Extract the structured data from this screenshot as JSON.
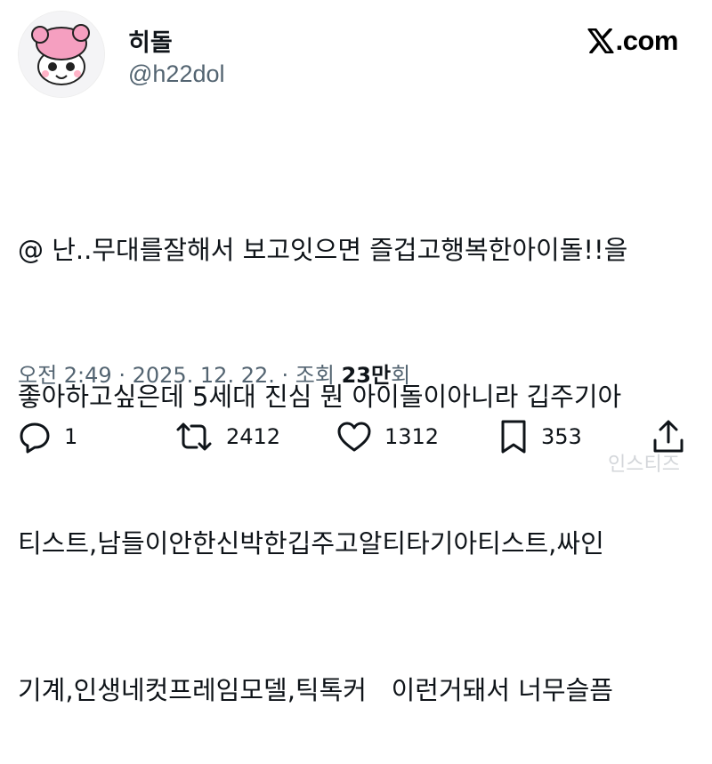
{
  "user": {
    "display_name": "히돌",
    "handle": "@h22dol"
  },
  "brand": {
    "label": ".com"
  },
  "tweet": {
    "lines": [
      "@ 난..무대를잘해서 보고잇으면 즐겁고행복한아이돌!!을",
      "좋아하고싶은데 5세대 진심 뭔 아이돌이아니라 깁주기아",
      "티스트,남들이안한신박한깁주고알티타기아티스트,싸인",
      "기계,인생네컷프레임모델,틱톡커   이런거돼서 너무슬픔"
    ]
  },
  "meta": {
    "time": "오전 2:49",
    "sep1": " · ",
    "date": "2025. 12. 22.",
    "sep2": " · ",
    "views_label": "조회 ",
    "views_value": "23만",
    "views_suffix": "회"
  },
  "actions": {
    "replies": "1",
    "retweets": "2412",
    "likes": "1312",
    "bookmarks": "353"
  },
  "icons": {
    "reply": "reply-icon",
    "retweet": "retweet-icon",
    "like": "heart-icon",
    "bookmark": "bookmark-icon",
    "share": "share-icon",
    "x_logo": "x-logo-icon"
  },
  "watermark": "인스티즈"
}
